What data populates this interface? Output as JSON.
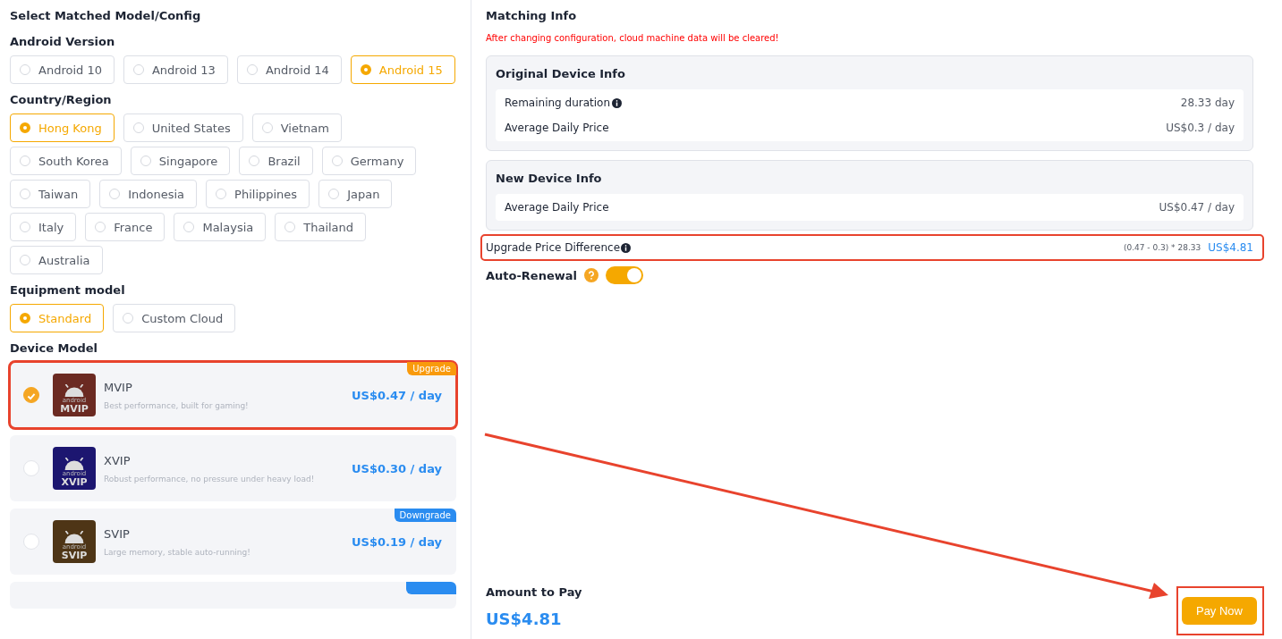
{
  "left": {
    "title": "Select Matched Model/Config",
    "android_version": {
      "label": "Android Version",
      "options": [
        {
          "label": "Android 10",
          "selected": false
        },
        {
          "label": "Android 13",
          "selected": false
        },
        {
          "label": "Android 14",
          "selected": false
        },
        {
          "label": "Android 15",
          "selected": true
        }
      ]
    },
    "region": {
      "label": "Country/Region",
      "options": [
        {
          "label": "Hong Kong",
          "selected": true
        },
        {
          "label": "United States",
          "selected": false
        },
        {
          "label": "Vietnam",
          "selected": false
        },
        {
          "label": "South Korea",
          "selected": false
        },
        {
          "label": "Singapore",
          "selected": false
        },
        {
          "label": "Brazil",
          "selected": false
        },
        {
          "label": "Germany",
          "selected": false
        },
        {
          "label": "Taiwan",
          "selected": false
        },
        {
          "label": "Indonesia",
          "selected": false
        },
        {
          "label": "Philippines",
          "selected": false
        },
        {
          "label": "Japan",
          "selected": false
        },
        {
          "label": "Italy",
          "selected": false
        },
        {
          "label": "France",
          "selected": false
        },
        {
          "label": "Malaysia",
          "selected": false
        },
        {
          "label": "Thailand",
          "selected": false
        },
        {
          "label": "Australia",
          "selected": false
        }
      ]
    },
    "equipment": {
      "label": "Equipment model",
      "options": [
        {
          "label": "Standard",
          "selected": true
        },
        {
          "label": "Custom Cloud",
          "selected": false
        }
      ]
    },
    "device_model": {
      "label": "Device Model",
      "items": [
        {
          "name": "MVIP",
          "icon_label": "android",
          "icon_name": "MVIP",
          "color": "#6b2a22",
          "description": "Best performance, built for gaming!",
          "price": "US$0.47 / day",
          "badge": {
            "label": "Upgrade",
            "color": "#f99a0c"
          },
          "selected": true,
          "highlighted": true
        },
        {
          "name": "XVIP",
          "icon_label": "android",
          "icon_name": "XVIP",
          "color": "#1c1670",
          "description": "Robust performance, no pressure under heavy load!",
          "price": "US$0.30 / day",
          "selected": false,
          "highlighted": false
        },
        {
          "name": "SVIP",
          "icon_label": "android",
          "icon_name": "SVIP",
          "color": "#4e3516",
          "description": "Large memory, stable auto-running!",
          "price": "US$0.19 / day",
          "badge": {
            "label": "Downgrade",
            "color": "#2a8cf0"
          },
          "selected": false,
          "highlighted": false
        }
      ],
      "cut_item": {
        "badge": {
          "color": "#2a8cf0"
        }
      }
    }
  },
  "right": {
    "title": "Matching Info",
    "warning": "After changing configuration, cloud machine data will be cleared!",
    "original": {
      "title": "Original Device Info",
      "rows": [
        {
          "label": "Remaining duration",
          "info": true,
          "value": "28.33 day"
        },
        {
          "label": "Average Daily Price",
          "info": false,
          "value": "US$0.3 / day"
        }
      ]
    },
    "new": {
      "title": "New Device Info",
      "rows": [
        {
          "label": "Average Daily Price",
          "info": false,
          "value": "US$0.47 / day"
        }
      ]
    },
    "difference": {
      "label": "Upgrade Price Difference",
      "formula": "(0.47 - 0.3) * 28.33",
      "value": "US$4.81",
      "highlighted": true
    },
    "auto_renewal": {
      "label": "Auto-Renewal",
      "on": true
    },
    "amount": {
      "label": "Amount to Pay",
      "value": "US$4.81"
    },
    "pay_button": {
      "label": "Pay Now",
      "highlighted": true
    }
  }
}
